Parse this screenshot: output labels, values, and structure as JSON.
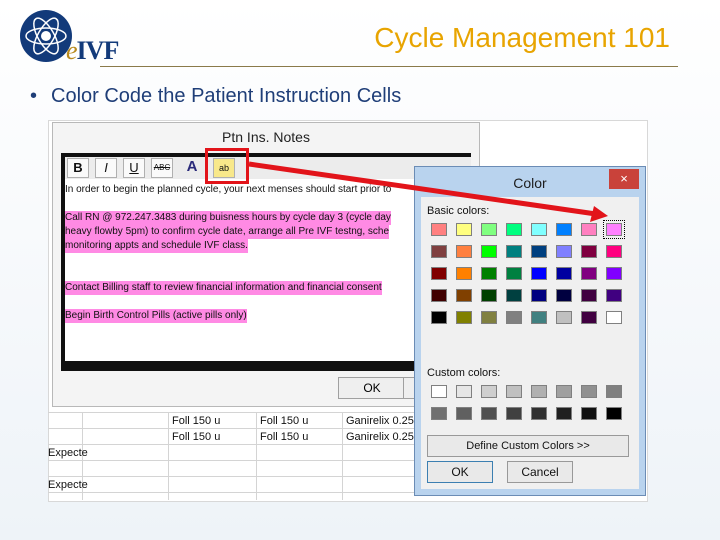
{
  "slide": {
    "title": "Cycle Management 101",
    "bullet": "Color Code the Patient Instruction Cells",
    "bullet_marker": "•",
    "logo_prefix": "e",
    "logo_text": "IVF"
  },
  "notes_dialog": {
    "title": "Ptn Ins. Notes",
    "toolbar": {
      "bold": "B",
      "italic": "I",
      "underline": "U",
      "strike": "ABC",
      "font_color": "A",
      "highlight": "ab"
    },
    "lines": [
      {
        "text": "In order to begin the planned cycle, your next menses should start prior to",
        "pink": false
      },
      {
        "text": "",
        "pink": false
      },
      {
        "text": "Call RN @ 972.247.3483 during buisness hours by cycle day 3 (cycle day",
        "pink": true
      },
      {
        "text": "heavy flowby 5pm) to confirm cycle date, arrange all Pre IVF testng, sche",
        "pink": true
      },
      {
        "text": "monitoring appts and schedule IVF class.",
        "pink": true
      },
      {
        "text": "",
        "pink": false
      },
      {
        "text": "",
        "pink": false
      },
      {
        "text": "Contact Billing staff to review financial information and financial consent",
        "pink": true
      },
      {
        "text": "",
        "pink": false
      },
      {
        "text": "Begin Birth Control Pills (active pills only)",
        "pink": true
      }
    ],
    "ok_label": "OK"
  },
  "sheet": {
    "rows": [
      [
        "Foll 150 u",
        "Foll 150 u",
        "Ganirelix 0.25"
      ],
      [
        "Foll 150 u",
        "Foll 150 u",
        "Ganirelix 0.25"
      ]
    ],
    "left_col": [
      "Expecte",
      "Expecte"
    ]
  },
  "color_dialog": {
    "title": "Color",
    "close_symbol": "×",
    "basic_label": "Basic colors:",
    "custom_label": "Custom colors:",
    "define_custom_label": "Define Custom Colors >>",
    "ok_label": "OK",
    "cancel_label": "Cancel",
    "selected_color": "#ff80ff",
    "basic_colors": [
      "#ff8080",
      "#ffff80",
      "#80ff80",
      "#00ff80",
      "#80ffff",
      "#0080ff",
      "#ff80c0",
      "#ff80ff",
      "#804040",
      "#ff8040",
      "#00ff00",
      "#008080",
      "#004080",
      "#8080ff",
      "#800040",
      "#ff0080",
      "#800000",
      "#ff8000",
      "#008000",
      "#008040",
      "#0000ff",
      "#0000a0",
      "#800080",
      "#8000ff",
      "#400000",
      "#804000",
      "#004000",
      "#004040",
      "#000080",
      "#000040",
      "#400040",
      "#400080",
      "#000000",
      "#808000",
      "#808040",
      "#808080",
      "#408080",
      "#c0c0c0",
      "#400040",
      "#ffffff"
    ],
    "custom_colors": [
      "#ffffff",
      "#e6e6e6",
      "#cfcfcf",
      "#c0c0c0",
      "#b0b0b0",
      "#a0a0a0",
      "#909090",
      "#808080",
      "#707070",
      "#606060",
      "#505050",
      "#404040",
      "#303030",
      "#202020",
      "#101010",
      "#000000"
    ]
  },
  "annotation_color": "#e2141a"
}
